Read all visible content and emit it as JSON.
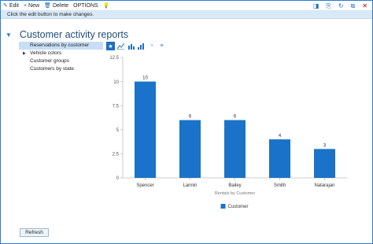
{
  "actionbar": {
    "edit": "Edit",
    "new": "New",
    "delete": "Delete",
    "options": "OPTIONS"
  },
  "message": "Click the edit button to make changes.",
  "page_title": "Customer activity reports",
  "nav": {
    "items": [
      "Reservations by customer",
      "Vehicle colors",
      "Customer groups",
      "Customers by state"
    ]
  },
  "refresh_label": "Refresh",
  "colors": {
    "accent": "#1f6fc4",
    "bar": "#1a73c8",
    "message_bg": "#d8e9f7"
  },
  "chart_data": {
    "type": "bar",
    "categories": [
      "Spencer",
      "Lannin",
      "Bailey",
      "Smith",
      "Natarajan"
    ],
    "series": [
      {
        "name": "Customer",
        "values": [
          10,
          6,
          6,
          4,
          3
        ]
      }
    ],
    "xlabel": "Rentals by Customer",
    "ylabel": "",
    "ylim": [
      0,
      12.5
    ],
    "yticks": [
      "0",
      "2.5",
      "5",
      "7.5",
      "10",
      "12.5"
    ],
    "data_labels": [
      "10",
      "6",
      "6",
      "4",
      "3"
    ],
    "legend": "bottom",
    "grid": false
  }
}
